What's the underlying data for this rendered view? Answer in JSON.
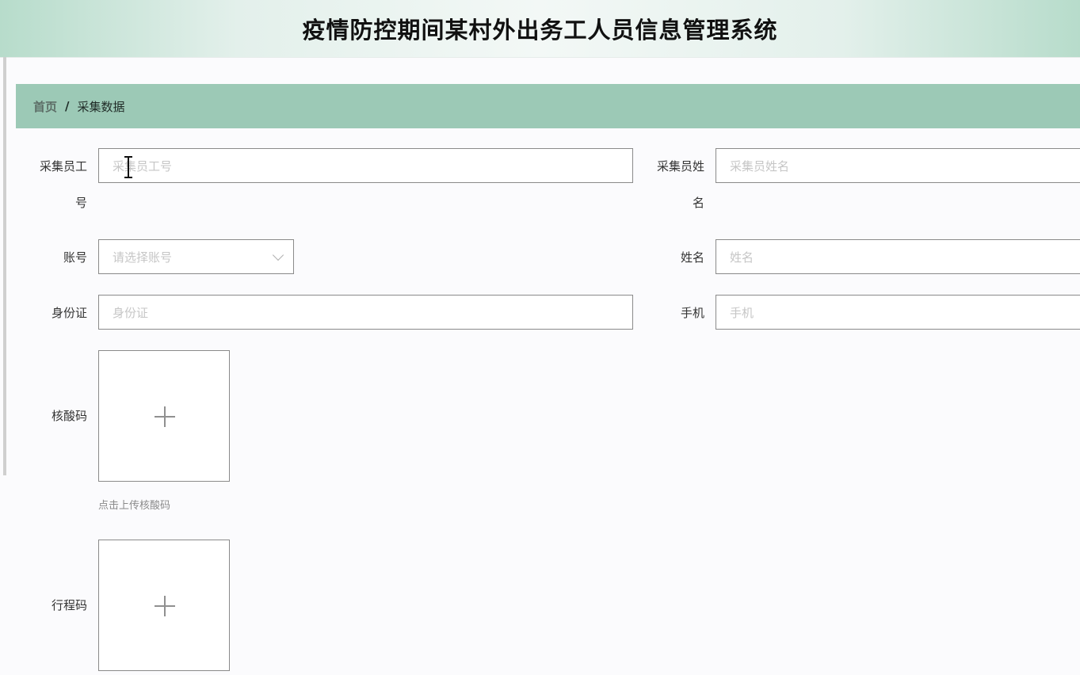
{
  "header": {
    "title": "疫情防控期间某村外出务工人员信息管理系统"
  },
  "breadcrumb": {
    "home": "首页",
    "separator": "/",
    "current": "采集数据"
  },
  "form": {
    "collector_id": {
      "label_line1": "采集员工",
      "label_line2": "号",
      "placeholder": "采集员工号"
    },
    "collector_name": {
      "label_line1": "采集员姓",
      "label_line2": "名",
      "placeholder": "采集员姓名"
    },
    "account": {
      "label": "账号",
      "placeholder": "请选择账号"
    },
    "name": {
      "label": "姓名",
      "placeholder": "姓名"
    },
    "id_card": {
      "label": "身份证",
      "placeholder": "身份证"
    },
    "phone": {
      "label": "手机",
      "placeholder": "手机"
    },
    "nucleic_code": {
      "label": "核酸码",
      "hint": "点击上传核酸码"
    },
    "travel_code": {
      "label": "行程码"
    }
  }
}
